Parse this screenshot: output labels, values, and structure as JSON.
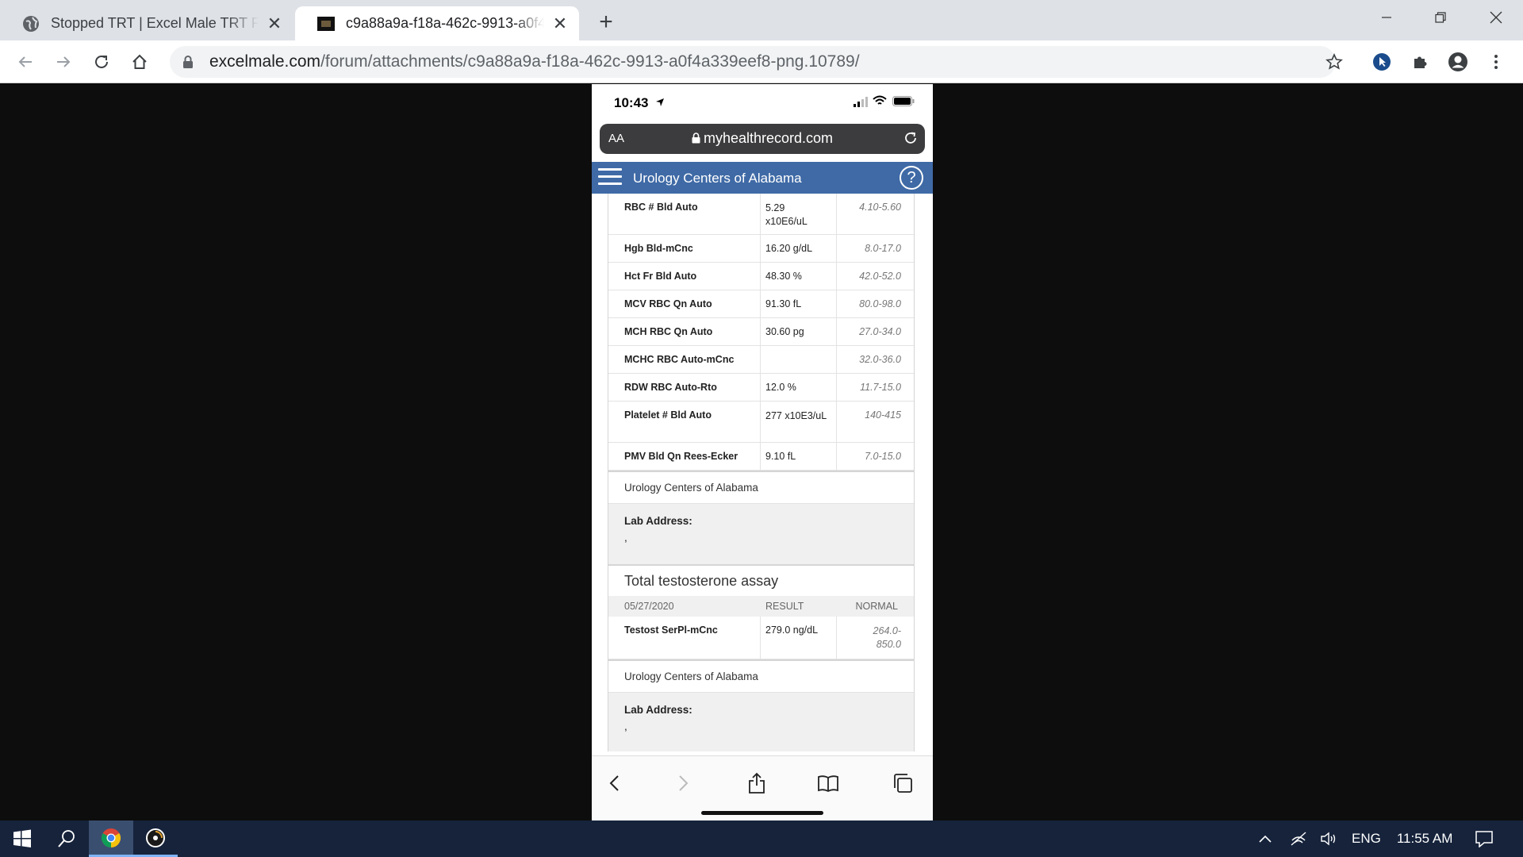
{
  "browser": {
    "tabs": [
      {
        "title": "Stopped TRT | Excel Male TRT For",
        "active": false
      },
      {
        "title": "c9a88a9a-f18a-462c-9913-a0f4a",
        "active": true
      }
    ],
    "url_domain": "excelmale.com",
    "url_path": "/forum/attachments/c9a88a9a-f18a-462c-9913-a0f4a339eef8-png.10789/"
  },
  "phone": {
    "time": "10:43",
    "safari_aa": "AA",
    "safari_url": "myhealthrecord.com",
    "site_title": "Urology Centers of Alabama",
    "help_glyph": "?",
    "cbc_rows": [
      {
        "test": "RBC # Bld Auto",
        "result": "5.29 x10E6/uL",
        "normal": "4.10-5.60"
      },
      {
        "test": "Hgb Bld-mCnc",
        "result": "16.20 g/dL",
        "normal": "8.0-17.0"
      },
      {
        "test": "Hct Fr Bld Auto",
        "result": "48.30 %",
        "normal": "42.0-52.0"
      },
      {
        "test": "MCV RBC Qn Auto",
        "result": "91.30 fL",
        "normal": "80.0-98.0"
      },
      {
        "test": "MCH RBC Qn Auto",
        "result": "30.60 pg",
        "normal": "27.0-34.0"
      },
      {
        "test": "MCHC RBC Auto-mCnc",
        "result": "",
        "normal": "32.0-36.0"
      },
      {
        "test": "RDW RBC Auto-Rto",
        "result": "12.0 %",
        "normal": "11.7-15.0"
      },
      {
        "test": "Platelet # Bld Auto",
        "result": "277 x10E3/uL",
        "normal": "140-415"
      },
      {
        "test": "PMV Bld Qn Rees-Ecker",
        "result": "9.10 fL",
        "normal": "7.0-15.0"
      }
    ],
    "lab_name_1": "Urology Centers of Alabama",
    "lab_address_label_1": "Lab Address:",
    "lab_address_value_1": ",",
    "assay_title": "Total testosterone assay",
    "assay_header": {
      "date": "05/27/2020",
      "result": "RESULT",
      "normal": "NORMAL"
    },
    "assay_row": {
      "test": "Testost SerPl-mCnc",
      "result": "279.0 ng/dL",
      "normal": "264.0-850.0"
    },
    "lab_name_2": "Urology Centers of Alabama",
    "lab_address_label_2": "Lab Address:",
    "lab_address_value_2": ","
  },
  "taskbar": {
    "language": "ENG",
    "clock": "11:55 AM"
  }
}
